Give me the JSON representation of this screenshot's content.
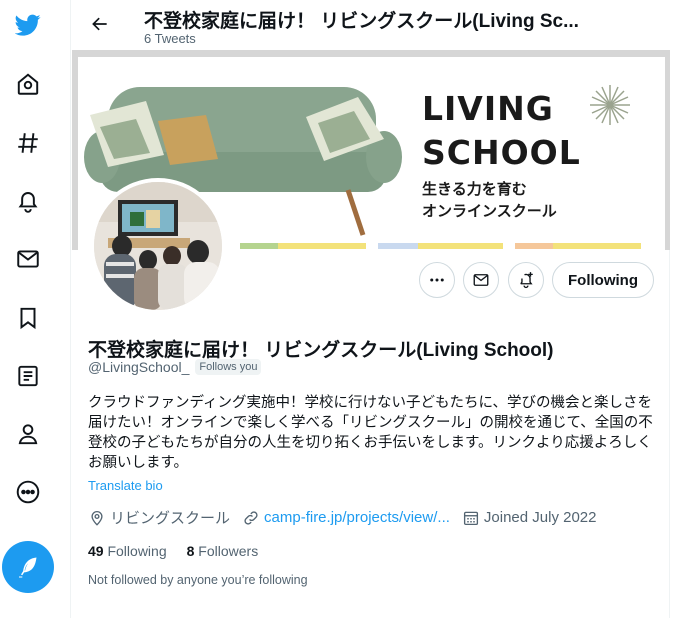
{
  "header": {
    "title": "不登校家庭に届け！ リビングスクール(Living Sc...",
    "subtitle": "6 Tweets"
  },
  "banner": {
    "brand_line1": "LIVING",
    "brand_line2": "SCHOOL",
    "tagline1": "生きる力を育む",
    "tagline2": "オンラインスクール",
    "stripe_colors": [
      "#b5d48f",
      "#f3e27a",
      "#c9d9ef",
      "#f5c79a"
    ]
  },
  "profile": {
    "name": "不登校家庭に届け！ リビングスクール(Living School)",
    "handle": "@LivingSchool_",
    "follows_you": "Follows you",
    "bio": "クラウドファンディング実施中！学校に行けない子どもたちに、学びの機会と楽しさを届けたい！オンラインで楽しく学べる「リビングスクール」の開校を通じて、全国の不登校の子どもたちが自分の人生を切り拓くお手伝いをします。リンクより応援よろしくお願いします。",
    "translate_label": "Translate bio",
    "location": "リビングスクール",
    "link": "camp-fire.jp/projects/view/...",
    "joined": "Joined July 2022",
    "following_count": "49",
    "following_label": "Following",
    "followers_count": "8",
    "followers_label": "Followers",
    "not_followed_note": "Not followed by anyone you’re following"
  },
  "actions": {
    "following_button": "Following"
  },
  "nav": {
    "icons": [
      "twitter-logo",
      "home-icon",
      "explore-icon",
      "notifications-icon",
      "messages-icon",
      "bookmarks-icon",
      "lists-icon",
      "profile-icon",
      "more-icon"
    ],
    "compose_icon": "feather-icon"
  },
  "colors": {
    "accent": "#1d9bf0",
    "text": "#0f1419",
    "muted": "#536471",
    "sofa": "#8aa58f"
  }
}
